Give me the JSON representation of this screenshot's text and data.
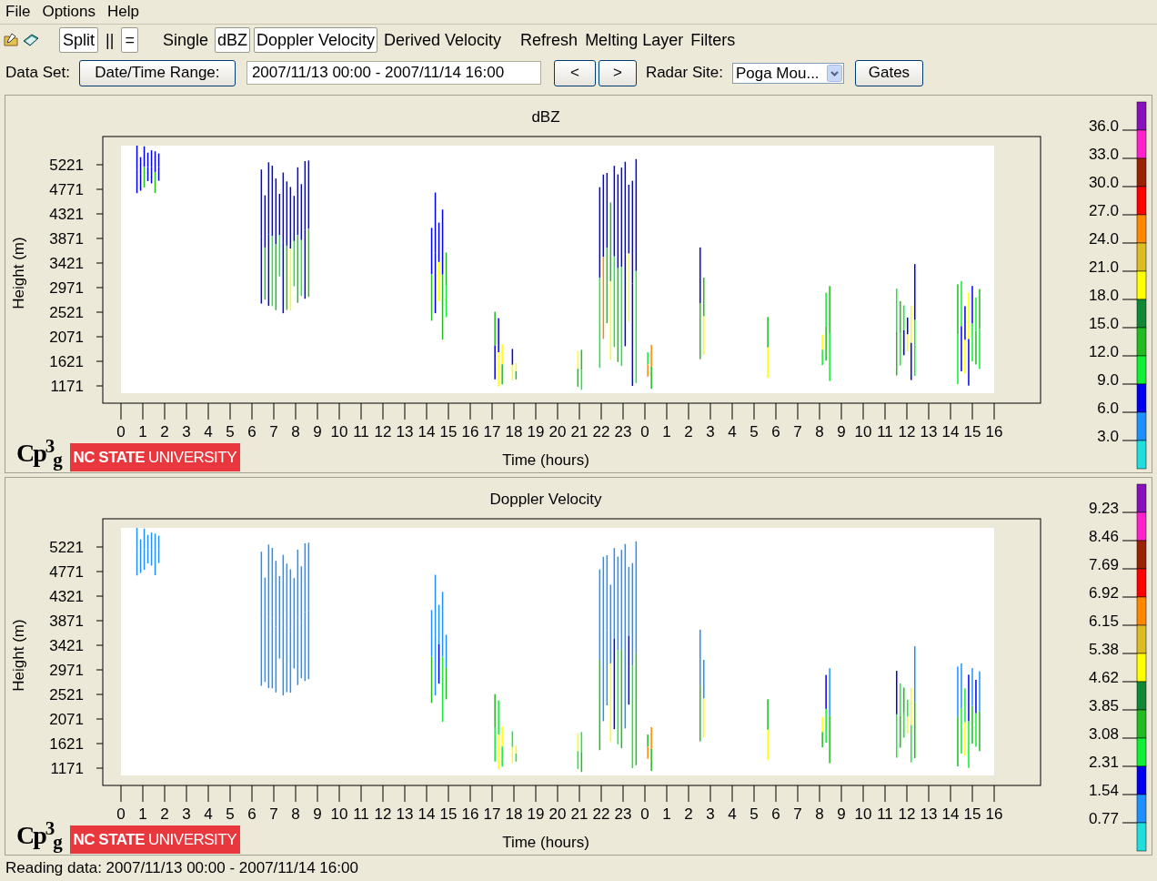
{
  "menu": [
    "File",
    "Options",
    "Help"
  ],
  "toolbar": {
    "layout_buttons": [
      {
        "label": "Split",
        "selected": true
      },
      {
        "label": "||",
        "selected": false
      },
      {
        "label": "=",
        "selected": true
      }
    ],
    "products": [
      {
        "label": "Single",
        "selected": false
      },
      {
        "label": "dBZ",
        "selected": true
      },
      {
        "label": "Doppler Velocity",
        "selected": true
      },
      {
        "label": "Derived Velocity",
        "selected": false
      }
    ],
    "actions": [
      "Refresh",
      "Melting Layer",
      "Filters"
    ]
  },
  "dataset": {
    "label": "Data Set:",
    "range_button": "Date/Time Range:",
    "range_value": "2007/11/13 00:00 - 2007/11/14 16:00",
    "prev": "<",
    "next": ">",
    "site_label": "Radar Site:",
    "site_value": "Poga Mou...",
    "gates": "Gates"
  },
  "panels": [
    {
      "title": "dBZ",
      "ylabel": "Height (m)",
      "xlabel": "Time (hours)",
      "yticks": [
        "5221",
        "4771",
        "4321",
        "3871",
        "3421",
        "2971",
        "2521",
        "2071",
        "1621",
        "1171"
      ],
      "xticks": [
        "0",
        "1",
        "2",
        "3",
        "4",
        "5",
        "6",
        "7",
        "8",
        "9",
        "10",
        "11",
        "12",
        "13",
        "14",
        "15",
        "16",
        "17",
        "18",
        "19",
        "20",
        "21",
        "22",
        "23",
        "0",
        "1",
        "2",
        "3",
        "4",
        "5",
        "6",
        "7",
        "8",
        "9",
        "10",
        "11",
        "12",
        "13",
        "14",
        "15",
        "16"
      ],
      "colorbar": {
        "labels": [
          "36.0",
          "33.0",
          "30.0",
          "27.0",
          "24.0",
          "21.0",
          "18.0",
          "15.0",
          "12.0",
          "9.0",
          "6.0",
          "3.0"
        ],
        "segments": [
          {
            "color": "#8811bb"
          },
          {
            "color": "#ff22cc"
          },
          {
            "color": "#992200"
          },
          {
            "color": "#ff0000"
          },
          {
            "color": "#ff8800"
          },
          {
            "color": "#ddbb22"
          },
          {
            "color": "#ffff00"
          },
          {
            "color": "#118833"
          },
          {
            "color": "#22bb22"
          },
          {
            "color": "#11ee33"
          },
          {
            "color": "#0000ee"
          },
          {
            "color": "#1e90ff"
          },
          {
            "color": "#22dddd"
          }
        ]
      },
      "logo": {
        "mark": "Cp$^{3}$$_{g}$",
        "bold": "NC STATE",
        "rest": "UNIVERSITY"
      }
    },
    {
      "title": "Doppler Velocity",
      "ylabel": "Height (m)",
      "xlabel": "Time (hours)",
      "yticks": [
        "5221",
        "4771",
        "4321",
        "3871",
        "3421",
        "2971",
        "2521",
        "2071",
        "1621",
        "1171"
      ],
      "xticks": [
        "0",
        "1",
        "2",
        "3",
        "4",
        "5",
        "6",
        "7",
        "8",
        "9",
        "10",
        "11",
        "12",
        "13",
        "14",
        "15",
        "16",
        "17",
        "18",
        "19",
        "20",
        "21",
        "22",
        "23",
        "0",
        "1",
        "2",
        "3",
        "4",
        "5",
        "6",
        "7",
        "8",
        "9",
        "10",
        "11",
        "12",
        "13",
        "14",
        "15",
        "16"
      ],
      "colorbar": {
        "labels": [
          "9.23",
          "8.46",
          "7.69",
          "6.92",
          "6.15",
          "5.38",
          "4.62",
          "3.85",
          "3.08",
          "2.31",
          "1.54",
          "0.77"
        ],
        "segments": [
          {
            "color": "#8811bb"
          },
          {
            "color": "#ff22cc"
          },
          {
            "color": "#992200"
          },
          {
            "color": "#ff0000"
          },
          {
            "color": "#ff8800"
          },
          {
            "color": "#ddbb22"
          },
          {
            "color": "#ffff00"
          },
          {
            "color": "#118833"
          },
          {
            "color": "#22bb22"
          },
          {
            "color": "#11ee33"
          },
          {
            "color": "#0000ee"
          },
          {
            "color": "#1e90ff"
          },
          {
            "color": "#22dddd"
          }
        ]
      },
      "logo": {
        "mark": "Cp$^{3}$$_{g}$",
        "bold": "NC STATE",
        "rest": "UNIVERSITY"
      }
    }
  ],
  "status": "Reading data: 2007/11/13 00:00 - 2007/11/14 16:00"
}
